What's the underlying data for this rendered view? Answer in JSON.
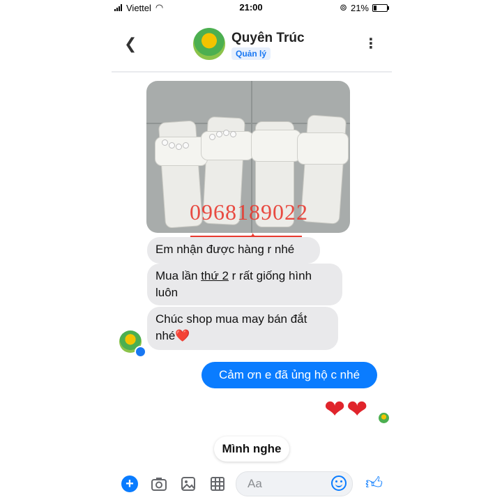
{
  "status": {
    "carrier": "Viettel",
    "time": "21:00",
    "battery": "21%",
    "battery_level": 0.21
  },
  "header": {
    "name": "Quyên Trúc",
    "role": "Quản lý"
  },
  "photo": {
    "watermark": "0968189022"
  },
  "messages": {
    "m1": "Em nhận được hàng r nhé",
    "m2_part1": "Mua lần ",
    "m2_underlined": "thứ 2",
    "m2_part2": " r rất giống hình",
    "m2_line2": "luôn",
    "m3_line1": "Chúc shop mua may bán đắt",
    "m3_line2": "nhé❤️",
    "out1": "Cảm ơn e đã ủng hộ c nhé",
    "hearts": "❤❤",
    "quick_reply": "Mình nghe"
  },
  "composer": {
    "placeholder": "Aa"
  },
  "colors": {
    "accent": "#0a7cff",
    "incoming_bubble": "#e9e9eb",
    "watermark": "#e8392f"
  }
}
